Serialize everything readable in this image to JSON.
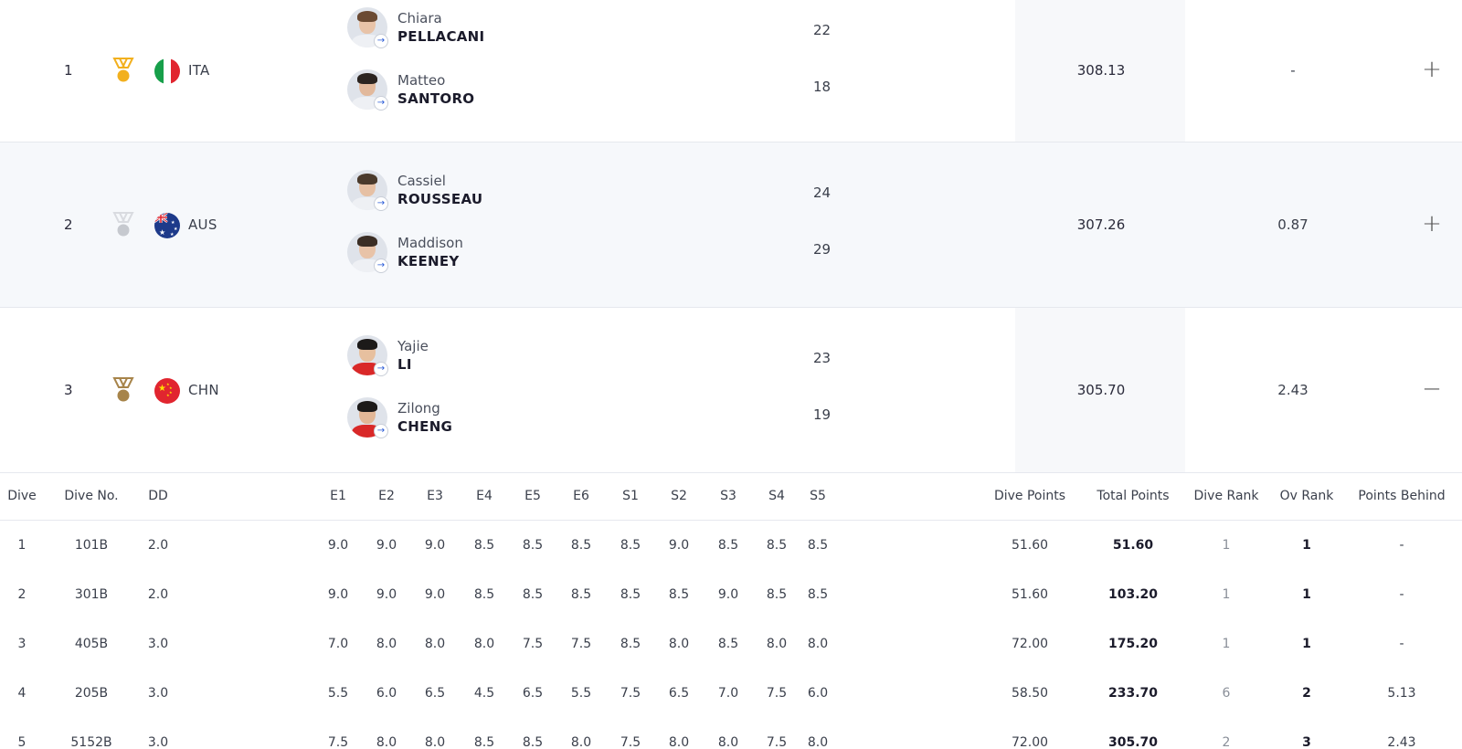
{
  "teams": [
    {
      "rank": "1",
      "medal": "gold",
      "noc": "ITA",
      "athletes": [
        {
          "first": "Chiara",
          "last": "PELLACANI",
          "age": "22"
        },
        {
          "first": "Matteo",
          "last": "SANTORO",
          "age": "18"
        }
      ],
      "total": "308.13",
      "behind": "-",
      "toggle": "+"
    },
    {
      "rank": "2",
      "medal": "silver",
      "noc": "AUS",
      "athletes": [
        {
          "first": "Cassiel",
          "last": "ROUSSEAU",
          "age": "24"
        },
        {
          "first": "Maddison",
          "last": "KEENEY",
          "age": "29"
        }
      ],
      "total": "307.26",
      "behind": "0.87",
      "toggle": "+"
    },
    {
      "rank": "3",
      "medal": "bronze",
      "noc": "CHN",
      "athletes": [
        {
          "first": "Yajie",
          "last": "LI",
          "age": "23"
        },
        {
          "first": "Zilong",
          "last": "CHENG",
          "age": "19"
        }
      ],
      "total": "305.70",
      "behind": "2.43",
      "toggle": "−"
    }
  ],
  "dive_table": {
    "headers": {
      "dive": "Dive",
      "dive_no": "Dive No.",
      "dd": "DD",
      "e1": "E1",
      "e2": "E2",
      "e3": "E3",
      "e4": "E4",
      "e5": "E5",
      "e6": "E6",
      "s1": "S1",
      "s2": "S2",
      "s3": "S3",
      "s4": "S4",
      "s5": "S5",
      "dive_points": "Dive Points",
      "total_points": "Total Points",
      "dive_rank": "Dive Rank",
      "ov_rank": "Ov Rank",
      "points_behind": "Points Behind"
    },
    "rows": [
      {
        "dive": "1",
        "dive_no": "101B",
        "dd": "2.0",
        "scores": [
          "9.0",
          "9.0",
          "9.0",
          "8.5",
          "8.5",
          "8.5",
          "8.5",
          "9.0",
          "8.5",
          "8.5",
          "8.5"
        ],
        "dive_points": "51.60",
        "total_points": "51.60",
        "dive_rank": "1",
        "ov_rank": "1",
        "points_behind": "-"
      },
      {
        "dive": "2",
        "dive_no": "301B",
        "dd": "2.0",
        "scores": [
          "9.0",
          "9.0",
          "9.0",
          "8.5",
          "8.5",
          "8.5",
          "8.5",
          "8.5",
          "9.0",
          "8.5",
          "8.5"
        ],
        "dive_points": "51.60",
        "total_points": "103.20",
        "dive_rank": "1",
        "ov_rank": "1",
        "points_behind": "-"
      },
      {
        "dive": "3",
        "dive_no": "405B",
        "dd": "3.0",
        "scores": [
          "7.0",
          "8.0",
          "8.0",
          "8.0",
          "7.5",
          "7.5",
          "8.5",
          "8.0",
          "8.5",
          "8.0",
          "8.0"
        ],
        "dive_points": "72.00",
        "total_points": "175.20",
        "dive_rank": "1",
        "ov_rank": "1",
        "points_behind": "-"
      },
      {
        "dive": "4",
        "dive_no": "205B",
        "dd": "3.0",
        "scores": [
          "5.5",
          "6.0",
          "6.5",
          "4.5",
          "6.5",
          "5.5",
          "7.5",
          "6.5",
          "7.0",
          "7.5",
          "6.0"
        ],
        "dive_points": "58.50",
        "total_points": "233.70",
        "dive_rank": "6",
        "ov_rank": "2",
        "points_behind": "5.13"
      },
      {
        "dive": "5",
        "dive_no": "5152B",
        "dd": "3.0",
        "scores": [
          "7.5",
          "8.0",
          "8.0",
          "8.5",
          "8.5",
          "8.0",
          "7.5",
          "8.0",
          "8.0",
          "7.5",
          "8.0"
        ],
        "dive_points": "72.00",
        "total_points": "305.70",
        "dive_rank": "2",
        "ov_rank": "3",
        "points_behind": "2.43"
      }
    ]
  },
  "colors": {
    "gold": "#f2b01e",
    "silver": "#c6c9cf",
    "bronze": "#a7844a",
    "link": "#2a5bd7"
  }
}
